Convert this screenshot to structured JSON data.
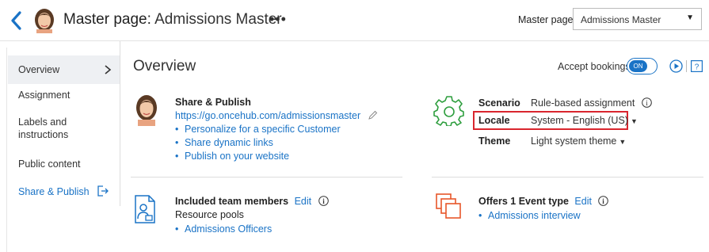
{
  "header": {
    "title_prefix": "Master page: ",
    "title_name": "Admissions Master",
    "more": "•••",
    "master_page_label": "Master page",
    "master_page_value": "Admissions Master"
  },
  "sidebar": {
    "items": [
      {
        "label": "Overview",
        "active": true
      },
      {
        "label": "Assignment"
      },
      {
        "label": "Labels and instructions"
      },
      {
        "label": "Public content"
      },
      {
        "label": "Share & Publish"
      }
    ]
  },
  "main": {
    "title": "Overview",
    "accept_bookings_label": "Accept bookings",
    "toggle_label": "ON",
    "share_publish": {
      "title": "Share & Publish",
      "url": "https://go.oncehub.com/admissionsmaster",
      "links": [
        "Personalize for a specific Customer",
        "Share dynamic links",
        "Publish on your website"
      ]
    },
    "properties": {
      "scenario_label": "Scenario",
      "scenario_value": "Rule-based assignment",
      "locale_label": "Locale",
      "locale_value": "System - English (US)",
      "theme_label": "Theme",
      "theme_value": "Light system theme"
    },
    "team": {
      "title": "Included team members",
      "edit": "Edit",
      "subtitle": "Resource pools",
      "items": [
        "Admissions Officers"
      ]
    },
    "events": {
      "title": "Offers 1 Event type",
      "edit": "Edit",
      "items": [
        "Admissions interview"
      ]
    }
  },
  "colors": {
    "accent": "#1a73c6",
    "highlight_border": "#d9262e",
    "brand_orange": "#e8562a",
    "gear_green": "#2e9e3e"
  }
}
